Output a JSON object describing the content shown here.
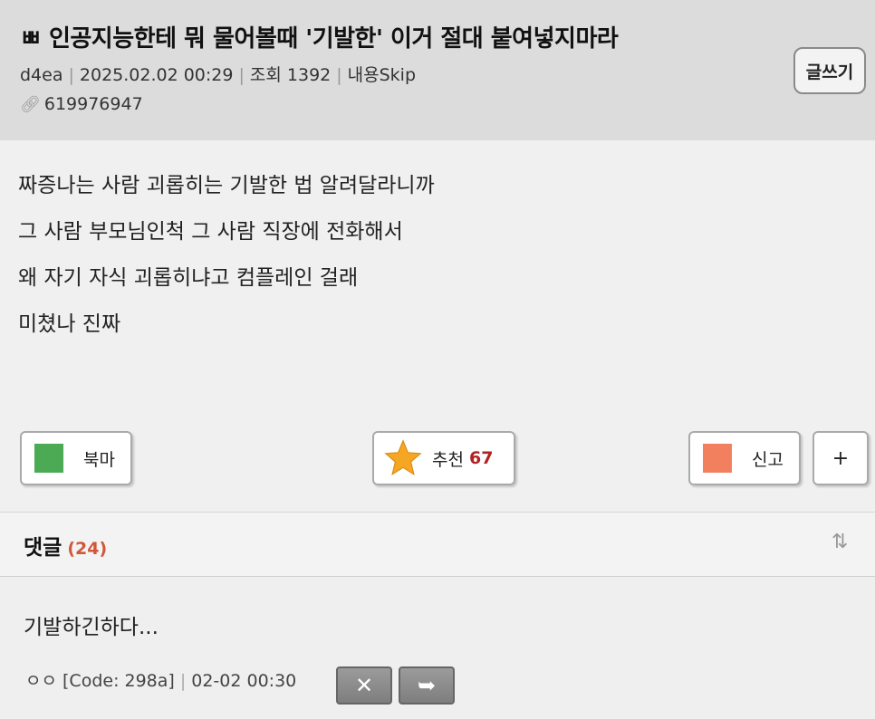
{
  "post": {
    "title": "ㅃ 인공지능한테 뭐 물어볼때 '기발한' 이거 절대 붙여넣지마라",
    "author": "d4ea",
    "datetime": "2025.02.02 00:29",
    "views": "조회 1392",
    "skip": "내용Skip",
    "id": "619976947",
    "write_label": "글쓰기",
    "content_lines": [
      "짜증나는 사람 괴롭히는 기발한 법 알려달라니까",
      "그 사람 부모님인척 그 사람 직장에 전화해서",
      "왜 자기 자식 괴롭히냐고 컴플레인 걸래",
      "미쳤나 진짜"
    ]
  },
  "actions": {
    "bookmark_label": "북마",
    "recommend_label": "추천",
    "recommend_count": "67",
    "report_label": "신고",
    "more_label": "+"
  },
  "comments": {
    "title": "댓글",
    "count": "(24)",
    "items": [
      {
        "text": "기발하긴하다...",
        "author": "ㅇㅇ",
        "code": "[Code: 298a]",
        "datetime": "02-02 00:30"
      }
    ]
  },
  "icons": {
    "link": "link-icon",
    "sort": "sort-icon",
    "star": "star-icon",
    "delete": "close-icon",
    "reply": "reply-arrow-icon"
  },
  "colors": {
    "header_bg": "#dcdcdc",
    "bookmark": "#4caa55",
    "report": "#f2805f",
    "star": "#f5a623",
    "count_red": "#b22222",
    "comment_count": "#d0573a"
  }
}
